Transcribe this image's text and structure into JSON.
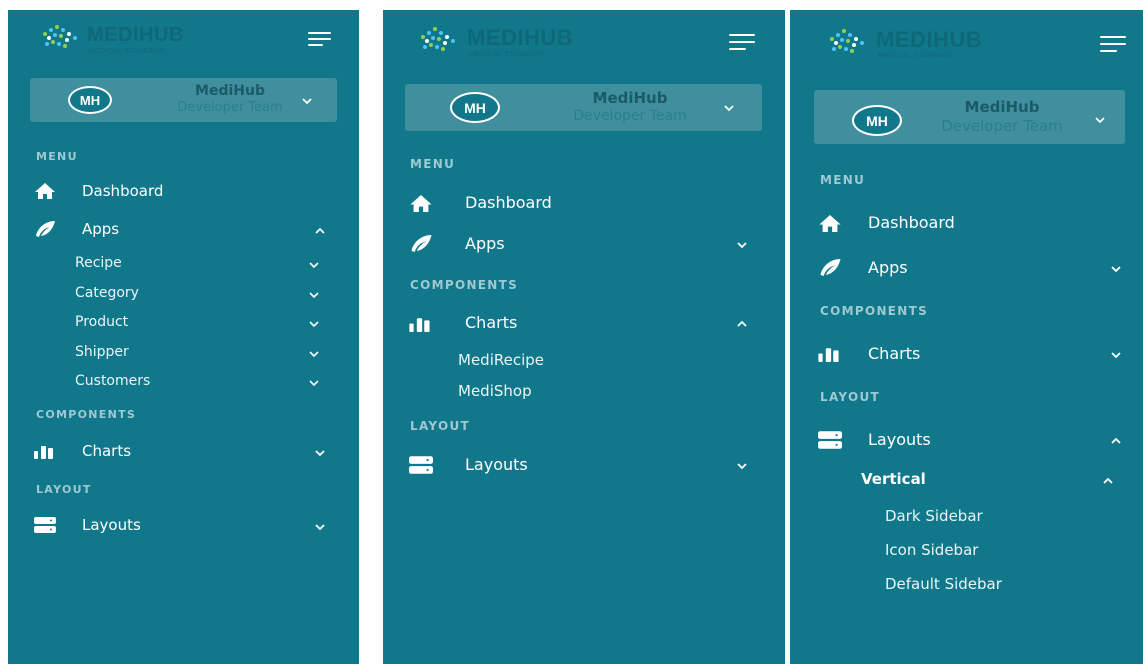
{
  "brand": {
    "name": "MEDIHUB",
    "tagline": "MEDICAL STANDARD"
  },
  "user": {
    "initials": "MH",
    "name": "MediHub",
    "team": "Developer Team"
  },
  "colors": {
    "sidebar_bg": "#11788b",
    "card_bg": "#3f8f9e",
    "section_text": "#9fc9d2",
    "text": "#ffffff"
  },
  "panels": [
    {
      "menu_section": "MENU",
      "dashboard": "Dashboard",
      "apps": {
        "label": "Apps",
        "state": "expanded"
      },
      "apps_children": [
        "Recipe",
        "Category",
        "Product",
        "Shipper",
        "Customers"
      ],
      "components_section": "COMPONENTS",
      "charts": {
        "label": "Charts",
        "state": "collapsed"
      },
      "layout_section": "LAYOUT",
      "layouts": {
        "label": "Layouts",
        "state": "collapsed"
      }
    },
    {
      "menu_section": "MENU",
      "dashboard": "Dashboard",
      "apps": {
        "label": "Apps",
        "state": "collapsed"
      },
      "components_section": "COMPONENTS",
      "charts": {
        "label": "Charts",
        "state": "expanded"
      },
      "charts_children": [
        "MediRecipe",
        "MediShop"
      ],
      "layout_section": "LAYOUT",
      "layouts": {
        "label": "Layouts",
        "state": "collapsed"
      }
    },
    {
      "menu_section": "MENU",
      "dashboard": "Dashboard",
      "apps": {
        "label": "Apps",
        "state": "collapsed"
      },
      "components_section": "COMPONENTS",
      "charts": {
        "label": "Charts",
        "state": "collapsed"
      },
      "layout_section": "LAYOUT",
      "layouts": {
        "label": "Layouts",
        "state": "expanded"
      },
      "vertical": {
        "label": "Vertical",
        "state": "expanded"
      },
      "vertical_children": [
        "Dark Sidebar",
        "Icon Sidebar",
        "Default Sidebar"
      ]
    }
  ],
  "icons": {
    "dashboard": "home-icon",
    "apps": "feather-icon",
    "charts": "bar-chart-icon",
    "layouts": "server-icon",
    "menu_toggle": "hamburger-icon",
    "expand": "chevron-down-icon",
    "collapse": "chevron-up-icon"
  }
}
